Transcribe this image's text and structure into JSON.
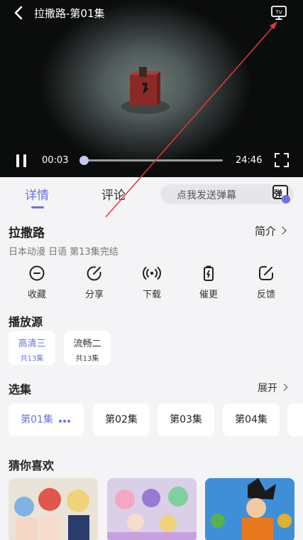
{
  "player": {
    "title": "拉撒路-第01集",
    "current_time": "00:03",
    "total_time": "24:46",
    "progress": 0.0,
    "tv_icon_label": "TV",
    "icons": [
      "back-arrow-icon",
      "tv-cast-icon",
      "pause-icon",
      "fullscreen-icon"
    ]
  },
  "tabs": [
    {
      "label": "详情",
      "active": true
    },
    {
      "label": "评论",
      "active": false
    }
  ],
  "danmaku": {
    "placeholder": "点我发送弹幕",
    "button_char": "弹"
  },
  "show": {
    "title": "拉撒路",
    "intro_label": "简介",
    "meta": "日本动漫 日语 第13集完结"
  },
  "actions": [
    {
      "label": "收藏",
      "icon": "favorite-icon"
    },
    {
      "label": "分享",
      "icon": "share-icon"
    },
    {
      "label": "下载",
      "icon": "download-icon"
    },
    {
      "label": "催更",
      "icon": "urge-update-icon"
    },
    {
      "label": "反馈",
      "icon": "feedback-icon"
    }
  ],
  "sources": {
    "title": "播放源",
    "items": [
      {
        "name": "高清三",
        "count": "共13集",
        "selected": true
      },
      {
        "name": "流畅二",
        "count": "共13集",
        "selected": false
      }
    ]
  },
  "episodes": {
    "title": "选集",
    "expand_label": "展开",
    "items": [
      {
        "label": "第01集",
        "selected": true
      },
      {
        "label": "第02集",
        "selected": false
      },
      {
        "label": "第03集",
        "selected": false
      },
      {
        "label": "第04集",
        "selected": false
      }
    ]
  },
  "recommend": {
    "title": "猜你喜欢"
  },
  "colors": {
    "accent": "#6c73e0",
    "background": "#f4f4f6",
    "annotation": "#e53935"
  }
}
